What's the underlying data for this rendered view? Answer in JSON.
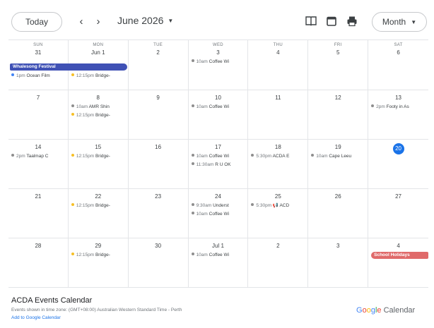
{
  "toolbar": {
    "today_label": "Today",
    "prev_label": "‹",
    "next_label": "›",
    "month_label": "June 2026",
    "view_label": "Month"
  },
  "weekdays": [
    "SUN",
    "MON",
    "TUE",
    "WED",
    "THU",
    "FRI",
    "SAT"
  ],
  "weeks": [
    {
      "days": [
        {
          "num": "31",
          "events": []
        },
        {
          "num": "Jun 1",
          "events": []
        },
        {
          "num": "2",
          "events": []
        },
        {
          "num": "3",
          "events": [
            {
              "time": "10am",
              "title": "Coffee Wi",
              "color": "#8e8e8e"
            }
          ]
        },
        {
          "num": "4",
          "events": []
        },
        {
          "num": "5",
          "events": []
        },
        {
          "num": "6",
          "events": []
        }
      ],
      "banner": {
        "label": "Whalesong Festival",
        "color": "#3f51b5"
      },
      "extra": [
        {
          "time": "1pm",
          "title": "Ocean Film",
          "color": "#4285f4"
        },
        {
          "time": "12:15pm",
          "title": "Bridge-",
          "color": "#f6bf26"
        }
      ]
    },
    {
      "days": [
        {
          "num": "7",
          "events": []
        },
        {
          "num": "8",
          "events": [
            {
              "time": "10am",
              "title": "AMR Shin",
              "color": "#8e8e8e"
            },
            {
              "time": "12:15pm",
              "title": "Bridge-",
              "color": "#f6bf26"
            }
          ]
        },
        {
          "num": "9",
          "events": []
        },
        {
          "num": "10",
          "events": [
            {
              "time": "10am",
              "title": "Coffee Wi",
              "color": "#8e8e8e"
            }
          ]
        },
        {
          "num": "11",
          "events": []
        },
        {
          "num": "12",
          "events": []
        },
        {
          "num": "13",
          "events": [
            {
              "time": "2pm",
              "title": "Footy in As",
              "color": "#8e8e8e"
            }
          ]
        }
      ]
    },
    {
      "days": [
        {
          "num": "14",
          "events": [
            {
              "time": "2pm",
              "title": "Taalmap C",
              "color": "#8e8e8e"
            }
          ]
        },
        {
          "num": "15",
          "events": [
            {
              "time": "12:15pm",
              "title": "Bridge-",
              "color": "#f6bf26"
            }
          ]
        },
        {
          "num": "16",
          "events": []
        },
        {
          "num": "17",
          "events": [
            {
              "time": "10am",
              "title": "Coffee Wi",
              "color": "#8e8e8e"
            },
            {
              "time": "11:30am",
              "title": "R U OK",
              "color": "#8e8e8e"
            }
          ]
        },
        {
          "num": "18",
          "events": [
            {
              "time": "5:30pm",
              "title": "ACDA E",
              "color": "#8e8e8e"
            }
          ]
        },
        {
          "num": "19",
          "events": [
            {
              "time": "10am",
              "title": "Cape Leeu",
              "color": "#8e8e8e"
            }
          ]
        },
        {
          "num": "20",
          "today": true,
          "events": []
        }
      ]
    },
    {
      "days": [
        {
          "num": "21",
          "events": []
        },
        {
          "num": "22",
          "events": [
            {
              "time": "12:15pm",
              "title": "Bridge-",
              "color": "#f6bf26"
            }
          ]
        },
        {
          "num": "23",
          "events": []
        },
        {
          "num": "24",
          "events": [
            {
              "time": "9:30am",
              "title": "Underst",
              "color": "#8e8e8e"
            },
            {
              "time": "10am",
              "title": "Coffee Wi",
              "color": "#8e8e8e"
            }
          ]
        },
        {
          "num": "25",
          "events": [
            {
              "time": "5:30pm",
              "title": "📢 ACD",
              "color": "#8e8e8e"
            }
          ]
        },
        {
          "num": "26",
          "events": []
        },
        {
          "num": "27",
          "events": []
        }
      ]
    },
    {
      "days": [
        {
          "num": "28",
          "events": []
        },
        {
          "num": "29",
          "events": [
            {
              "time": "12:15pm",
              "title": "Bridge-",
              "color": "#f6bf26"
            }
          ]
        },
        {
          "num": "30",
          "events": []
        },
        {
          "num": "Jul 1",
          "events": [
            {
              "time": "10am",
              "title": "Coffee Wi",
              "color": "#8e8e8e"
            }
          ]
        },
        {
          "num": "2",
          "events": []
        },
        {
          "num": "3",
          "events": []
        },
        {
          "num": "4",
          "events": []
        }
      ],
      "banner_end": {
        "label": "School Holidays",
        "color": "#e06a6a"
      }
    }
  ],
  "footer": {
    "calendar_name": "ACDA Events Calendar",
    "timezone_note": "Events shown in time zone: (GMT+08:00) Australian Western Standard Time - Perth",
    "add_link": "Add to Google Calendar",
    "branding_google": "Google",
    "branding_calendar": "Calendar"
  },
  "colors": {
    "accent": "#1a73e8",
    "today_circle": "#1a73e8",
    "banner_blue": "#3f51b5",
    "banner_red": "#e06a6a",
    "border": "#e3e5e8"
  },
  "icons": [
    "chevron-left-icon",
    "chevron-right-icon",
    "agenda-view-icon",
    "calendar-view-icon",
    "print-icon",
    "caret-down-icon"
  ]
}
